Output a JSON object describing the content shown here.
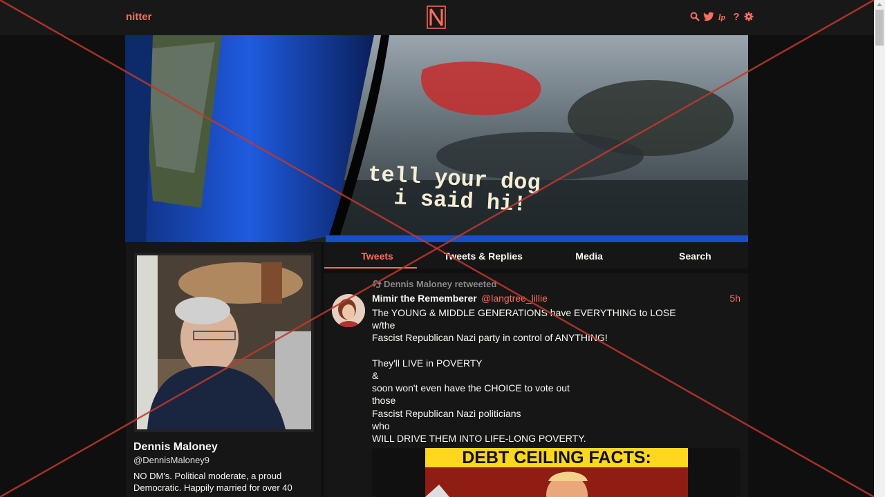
{
  "nav": {
    "brand": "nitter",
    "logo_letter": "N",
    "icons": [
      "search-icon",
      "twitter-icon",
      "liberapay-icon",
      "help-icon",
      "gear-icon"
    ],
    "help_glyph": "?"
  },
  "colors": {
    "accent": "#ff6c60",
    "background": "#0f0f0f",
    "panel": "#161616",
    "overlay_x": "#c0392b"
  },
  "banner": {
    "caption_line1": "tell your dog",
    "caption_line2": "i said hi!"
  },
  "profile": {
    "fullname": "Dennis Maloney",
    "username": "@DennisMaloney9",
    "bio": "NO DM's. Political moderate, a proud Democratic. Happily married for over 40"
  },
  "tabs": [
    {
      "label": "Tweets",
      "active": true
    },
    {
      "label": "Tweets & Replies",
      "active": false
    },
    {
      "label": "Media",
      "active": false
    },
    {
      "label": "Search",
      "active": false
    }
  ],
  "tweet": {
    "retweet_header": "Dennis Maloney retweeted",
    "fullname": "Mimir the Rememberer",
    "handle": "@langtree_lillie",
    "date": "5h",
    "content": "The YOUNG & MIDDLE GENERATIONS have EVERYTHING to LOSE\nw/the\nFascist Republican Nazi party in control of ANYTHING!\n\nThey'll LIVE in POVERTY\n&\nsoon won't even have the CHOICE to vote out\nthose\nFascist Republican Nazi politicians\nwho\nWILL DRIVE THEM INTO LIFE-LONG POVERTY.",
    "attachment_headline": "DEBT CEILING FACTS:"
  }
}
